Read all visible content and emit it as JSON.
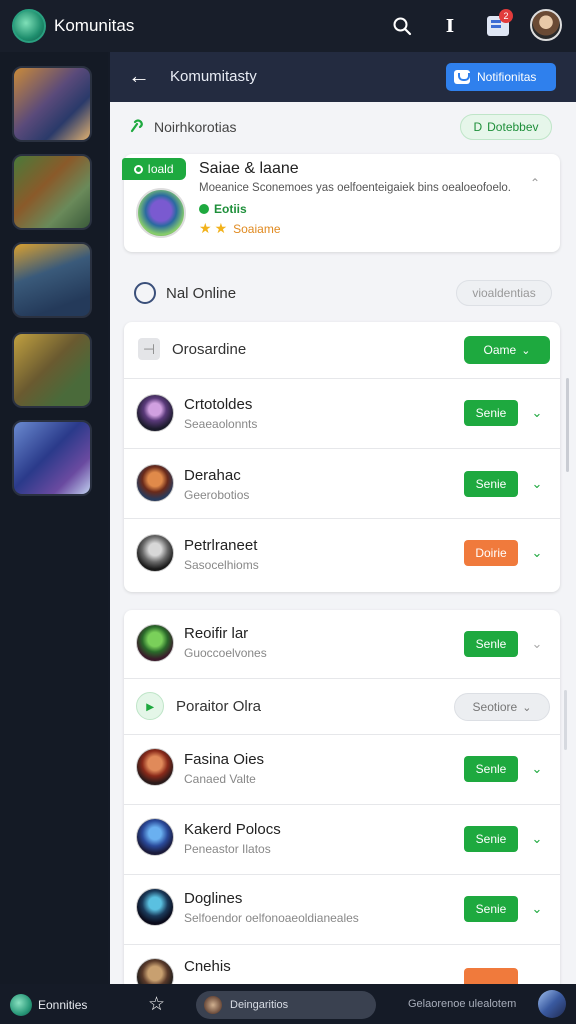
{
  "topbar": {
    "app_title": "Komunitas",
    "inbox_badge": "2"
  },
  "panel": {
    "title": "Komumitasty",
    "notifications_button": "Notifionitas"
  },
  "notif_section": {
    "label": "Noirhkorotias",
    "pill": "Dotebbev"
  },
  "notif_card": {
    "tag": "Ioald",
    "title": "Saiae & laane",
    "desc": "Moeanice Sconemoes yas oelfoenteigaiek bins oealoeofoelo.",
    "status": "Eotiis",
    "rating_label": "Soaiame"
  },
  "not_online": {
    "label": "Nal Online",
    "pill": "vioaldentias"
  },
  "group1": {
    "header": {
      "label": "Orosardine",
      "pill": "Oame"
    },
    "entries": [
      {
        "name": "Crtotoldes",
        "sub": "Seaeaolonnts",
        "button": "Senie"
      },
      {
        "name": "Derahac",
        "sub": "Geerobotios",
        "button": "Senie"
      },
      {
        "name": "Petrlraneet",
        "sub": "Sasocelhioms",
        "button": "Doirie"
      }
    ]
  },
  "group2": {
    "first": {
      "name": "Reoifir lar",
      "sub": "Guoccoelvones",
      "button": "Senle"
    },
    "header": {
      "label": "Poraitor Olra",
      "pill": "Seotiore"
    },
    "entries": [
      {
        "name": "Fasina Oies",
        "sub": "Canaed Valte",
        "button": "Senle"
      },
      {
        "name": "Kakerd Polocs",
        "sub": "Peneastor Ilatos",
        "button": "Senie"
      },
      {
        "name": "Doglines",
        "sub": "Selfoendor oelfonoaeoldianeales",
        "button": "Senie"
      },
      {
        "name": "Cnehis",
        "sub": "",
        "button": ""
      }
    ]
  },
  "bottombar": {
    "label": "Eonnities",
    "pill_label": "Deingaritios",
    "right_label": "Gelaorenoe ulealotem"
  },
  "colors": {
    "accent": "#1ea93f",
    "orange": "#f07a3c",
    "blue": "#2f80ed",
    "header": "#232b40"
  }
}
